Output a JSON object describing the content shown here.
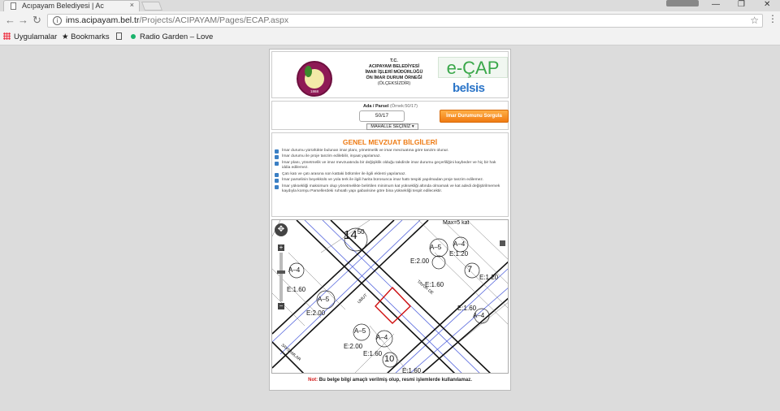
{
  "browser": {
    "tab_title": "Acıpayam Belediyesi | Ac",
    "tab_close": "×",
    "url_host": "ims.acipayam.bel.tr",
    "url_path": "/Projects/ACIPAYAM/Pages/ECAP.aspx",
    "window_controls": [
      "—",
      "❐",
      "✕"
    ],
    "bookmarks": [
      {
        "label": "Uygulamalar",
        "icon": "apps-grid-icon"
      },
      {
        "label": "Bookmarks",
        "icon": "star-icon"
      },
      {
        "label": "",
        "icon": "document-icon"
      },
      {
        "label": "Radio Garden – Love",
        "icon": "green-dot-icon"
      }
    ]
  },
  "header": {
    "logo_year": "1868",
    "line1": "T.C.",
    "line2": "ACIPAYAM BELEDİYESİ",
    "line3": "İMAR İŞLERİ MÜDÜRLÜĞÜ",
    "line4": "ÖN İMAR DURUM ÖRNEĞİ",
    "line5": "(ÖLÇEKSİZDİR)",
    "ecap": "e-ÇAP",
    "belsis": "belsis",
    "ecap_color": "#3aa84a",
    "belsis_color": "#2a74c8"
  },
  "query": {
    "label_bold": "Ada / Parsel",
    "label_example": "(Örnek:50/17)",
    "value": "50/17",
    "select": "MAHALLE SEÇİNİZ ▾",
    "button": "İmar Durumunu Sorgula",
    "button_color": "#f07b12"
  },
  "mevzuat": {
    "title": "GENEL MEVZUAT BİLGİLERİ",
    "items": [
      "İmar durumu yürürlükte bulunan imar planı, yönetmelik ve imar mevzuatına göre tanzim olunur.",
      "İmar durumu ile proje tanzim edilebilir, inşaat yapılamaz.",
      "İmar planı, yönetmelik ve imar mevzuatında bir değişiklik olduğu takdirde imar durumu geçerliliğini kaybeder ve hiç bir hak iddia edilemez.",
      "Çatı katı ve çatı arasına son kattaki bölümler ile ilgili eklenti yapılamaz.",
      "İmar parselinin beyekkülü ve yola terk ile ilgili harita bürosunca imar hattı tespiti yapılmadan proje tanzim edilemez.",
      "İmar yüksekliği maksimum olup yönetmelikte belirtilen minimum kat yüksekliği altında olmamak ve kat adedi değiştirilmemek kaydıyla komşu Parsellerdeki ruhsatlı yapı gabarisine göre bina yüksekliği tespit edilecektir."
    ]
  },
  "map": {
    "labels": {
      "max": "Max=5 kat",
      "big_number": "14",
      "big_sup": "50",
      "a5": "A–5",
      "a4": "A–4",
      "e200": "E:2.00",
      "e120": "E:1.20",
      "e160": "E:1.60",
      "seven": "7",
      "ten": "10",
      "street1": "TAVUK DE",
      "street2": "UMUT",
      "street3": "3AVSAMLAR"
    }
  },
  "note": {
    "title": "Not:",
    "text": " Bu belge bilgi amaçlı verilmiş olup, resmi işlemlerde kullanılamaz."
  }
}
